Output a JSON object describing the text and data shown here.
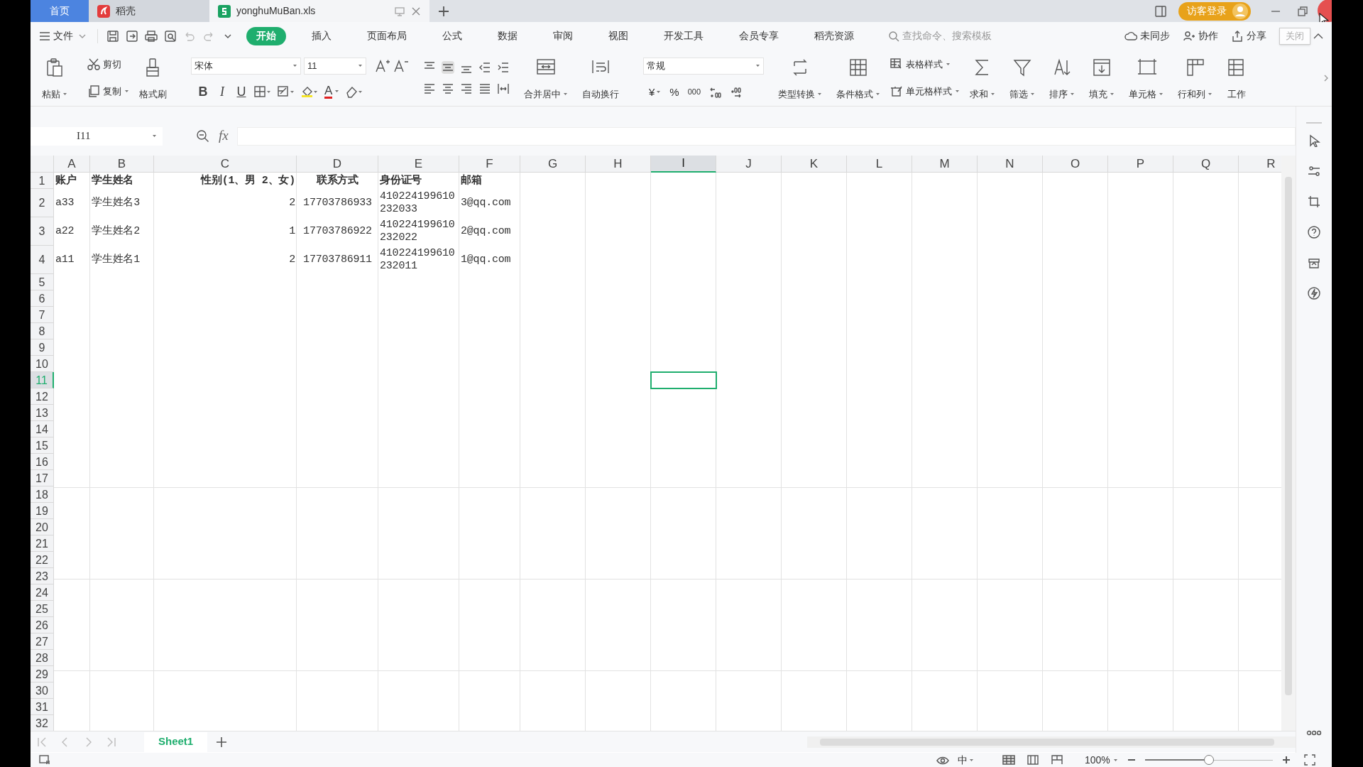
{
  "title_bar": {
    "tabs": [
      {
        "kind": "home",
        "label": "首页",
        "selected": false
      },
      {
        "kind": "app",
        "label": "稻壳",
        "selected": false
      },
      {
        "kind": "file",
        "label": "yonghuMuBan.xls",
        "selected": true
      }
    ],
    "login": "访客登录",
    "tooltip": "关闭"
  },
  "menu_bar": {
    "file": "文件",
    "tabs": [
      {
        "label": "开始",
        "selected": true
      },
      {
        "label": "插入",
        "selected": false
      },
      {
        "label": "页面布局",
        "selected": false
      },
      {
        "label": "公式",
        "selected": false
      },
      {
        "label": "数据",
        "selected": false
      },
      {
        "label": "审阅",
        "selected": false
      },
      {
        "label": "视图",
        "selected": false
      },
      {
        "label": "开发工具",
        "selected": false
      },
      {
        "label": "会员专享",
        "selected": false
      },
      {
        "label": "稻壳资源",
        "selected": false
      }
    ],
    "search": {
      "placeholder": "查找命令、搜索模板"
    },
    "actions": [
      "未同步",
      "协作",
      "分享"
    ]
  },
  "ribbon": [
    {
      "kind": "large",
      "label": "粘贴",
      "dropdown": true
    },
    {
      "kind": "stack",
      "items": [
        {
          "label": "剪切",
          "dropdown": false
        },
        {
          "label": "复制",
          "dropdown": true
        }
      ]
    },
    {
      "kind": "large",
      "label": "格式刷",
      "dropdown": false
    },
    {
      "kind": "font",
      "font": "宋体",
      "size": "11",
      "buttons": [
        "B",
        "I",
        "U"
      ],
      "color_letter": "A"
    },
    {
      "kind": "align"
    },
    {
      "kind": "large",
      "label": "合并居中",
      "dropdown": true
    },
    {
      "kind": "large",
      "label": "自动换行",
      "dropdown": false
    },
    {
      "kind": "number",
      "format": "常规",
      "buttons": [
        "¥",
        "%",
        "000"
      ]
    },
    {
      "kind": "large",
      "label": "类型转换",
      "dropdown": true
    },
    {
      "kind": "large",
      "label": "条件格式",
      "dropdown": true
    },
    {
      "kind": "stack",
      "items": [
        {
          "label": "表格样式",
          "dropdown": true
        },
        {
          "label": "单元格样式",
          "dropdown": true
        }
      ]
    },
    {
      "kind": "large",
      "label": "求和",
      "dropdown": true
    },
    {
      "kind": "large",
      "label": "筛选",
      "dropdown": true
    },
    {
      "kind": "large",
      "label": "排序",
      "dropdown": true
    },
    {
      "kind": "large",
      "label": "填充",
      "dropdown": true
    },
    {
      "kind": "large",
      "label": "单元格",
      "dropdown": true
    },
    {
      "kind": "large",
      "label": "行和列",
      "dropdown": true
    },
    {
      "kind": "large",
      "label": "工作",
      "dropdown": false
    }
  ],
  "formula_bar": {
    "name_box": "I11",
    "fx": "fx"
  },
  "sheet": {
    "columns": [
      {
        "label": "A",
        "selected": false
      },
      {
        "label": "B",
        "selected": false
      },
      {
        "label": "C",
        "selected": false
      },
      {
        "label": "D",
        "selected": false
      },
      {
        "label": "E",
        "selected": false
      },
      {
        "label": "F",
        "selected": false
      },
      {
        "label": "G",
        "selected": false
      },
      {
        "label": "H",
        "selected": false
      },
      {
        "label": "I",
        "selected": true
      },
      {
        "label": "J",
        "selected": false
      },
      {
        "label": "K",
        "selected": false
      },
      {
        "label": "L",
        "selected": false
      },
      {
        "label": "M",
        "selected": false
      },
      {
        "label": "N",
        "selected": false
      },
      {
        "label": "O",
        "selected": false
      },
      {
        "label": "P",
        "selected": false
      },
      {
        "label": "Q",
        "selected": false
      },
      {
        "label": "R",
        "selected": false
      }
    ],
    "rows": [
      {
        "label": "1",
        "selected": false,
        "cells": [
          "账户",
          "学生姓名",
          "性别(1、男 2、女)",
          "联系方式",
          "身份证号",
          "邮箱"
        ]
      },
      {
        "label": "2",
        "selected": false,
        "cells": [
          "a33",
          "学生姓名3",
          "2",
          "17703786933",
          "410224199610232033",
          "3@qq.com"
        ]
      },
      {
        "label": "3",
        "selected": false,
        "cells": [
          "a22",
          "学生姓名2",
          "1",
          "17703786922",
          "410224199610232022",
          "2@qq.com"
        ]
      },
      {
        "label": "4",
        "selected": false,
        "cells": [
          "a11",
          "学生姓名1",
          "2",
          "17703786911",
          "410224199610232011",
          "1@qq.com"
        ]
      },
      {
        "label": "5",
        "selected": false
      },
      {
        "label": "6",
        "selected": false
      },
      {
        "label": "7",
        "selected": false
      },
      {
        "label": "8",
        "selected": false
      },
      {
        "label": "9",
        "selected": false
      },
      {
        "label": "10",
        "selected": false
      },
      {
        "label": "11",
        "selected": true
      },
      {
        "label": "12",
        "selected": false
      },
      {
        "label": "13",
        "selected": false
      },
      {
        "label": "14",
        "selected": false
      },
      {
        "label": "15",
        "selected": false
      },
      {
        "label": "16",
        "selected": false
      },
      {
        "label": "17",
        "selected": false
      },
      {
        "label": "18",
        "selected": false
      },
      {
        "label": "19",
        "selected": false
      },
      {
        "label": "20",
        "selected": false
      },
      {
        "label": "21",
        "selected": false
      },
      {
        "label": "22",
        "selected": false
      },
      {
        "label": "23",
        "selected": false
      },
      {
        "label": "24",
        "selected": false
      },
      {
        "label": "25",
        "selected": false
      },
      {
        "label": "26",
        "selected": false
      },
      {
        "label": "27",
        "selected": false
      },
      {
        "label": "28",
        "selected": false
      },
      {
        "label": "29",
        "selected": false
      },
      {
        "label": "30",
        "selected": false
      },
      {
        "label": "31",
        "selected": false
      },
      {
        "label": "32",
        "selected": false
      }
    ]
  },
  "sheet_tabs": [
    {
      "label": "Sheet1",
      "selected": true
    }
  ],
  "status_bar": {
    "input_mode": "中",
    "zoom": "100%",
    "zoom_slider": {
      "level": 0.5
    }
  }
}
